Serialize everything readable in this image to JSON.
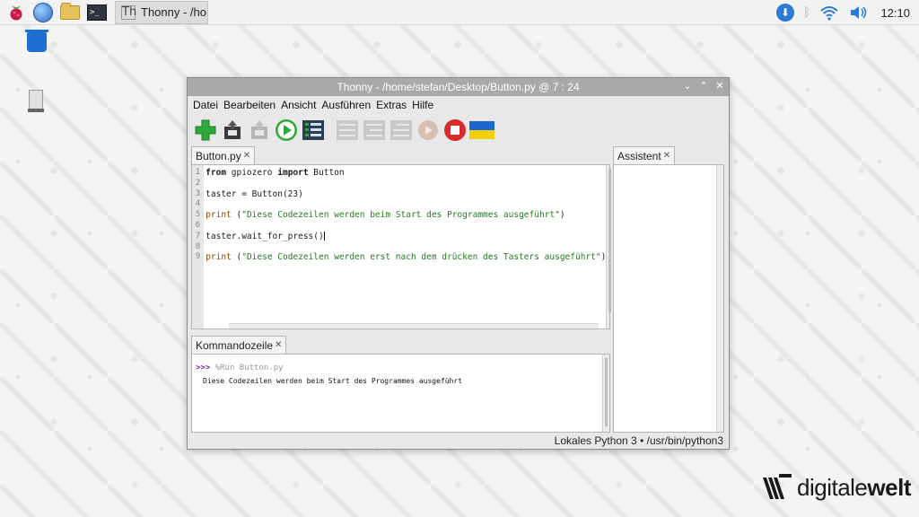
{
  "taskbar": {
    "task_title": "Thonny  -  /ho...",
    "clock": "12:10",
    "icons": [
      "raspberry-menu-icon",
      "browser-globe-icon",
      "file-manager-folder-icon",
      "terminal-icon"
    ],
    "terminal_glyph": ">_",
    "app_glyph": "Th"
  },
  "window": {
    "title": "Thonny  -  /home/stefan/Desktop/Button.py  @  7 : 24",
    "controls": {
      "minimize": "⌄",
      "maximize": "⌃",
      "close": "✕"
    },
    "menu": [
      "Datei",
      "Bearbeiten",
      "Ansicht",
      "Ausführen",
      "Extras",
      "Hilfe"
    ],
    "toolbar": [
      "new-file",
      "open-file",
      "save-file",
      "run",
      "debug",
      "step-over",
      "step-into",
      "step-out",
      "resume",
      "stop",
      "ukraine-flag"
    ]
  },
  "editor": {
    "tab_label": "Button.py",
    "line_numbers": [
      "1",
      "2",
      "3",
      "4",
      "5",
      "6",
      "7",
      "8",
      "9"
    ],
    "lines": [
      {
        "kw1": "from",
        "t1": " gpiozero ",
        "kw2": "import",
        "t2": " Button"
      },
      {
        "text": ""
      },
      {
        "text": "taster = Button(23)"
      },
      {
        "text": ""
      },
      {
        "fn": "print",
        "t1": " (",
        "str": "\"Diese Codezeilen werden beim Start des Programmes ausgeführt\"",
        "t2": ")"
      },
      {
        "text": ""
      },
      {
        "text": "taster.wait_for_press()"
      },
      {
        "text": ""
      },
      {
        "fn": "print",
        "t1": " (",
        "str": "\"Diese Codezeilen werden erst nach dem drücken des Tasters ausgeführt\"",
        "t2": ")"
      }
    ]
  },
  "shell": {
    "tab_label": "Kommandozeile",
    "prompt": ">>>",
    "command": " %Run Button.py",
    "output": "Diese Codezeilen werden beim Start des Programmes ausgeführt"
  },
  "assistant": {
    "tab_label": "Assistent"
  },
  "statusbar": {
    "text": "Lokales Python 3  •  /usr/bin/python3"
  },
  "watermark": {
    "text_regular": "digitale",
    "text_bold": "welt"
  },
  "colors": {
    "run_green": "#2fa83a",
    "stop_red": "#d92b2b",
    "keyword_string": "#237a1f",
    "prompt": "#7a1fa2"
  }
}
